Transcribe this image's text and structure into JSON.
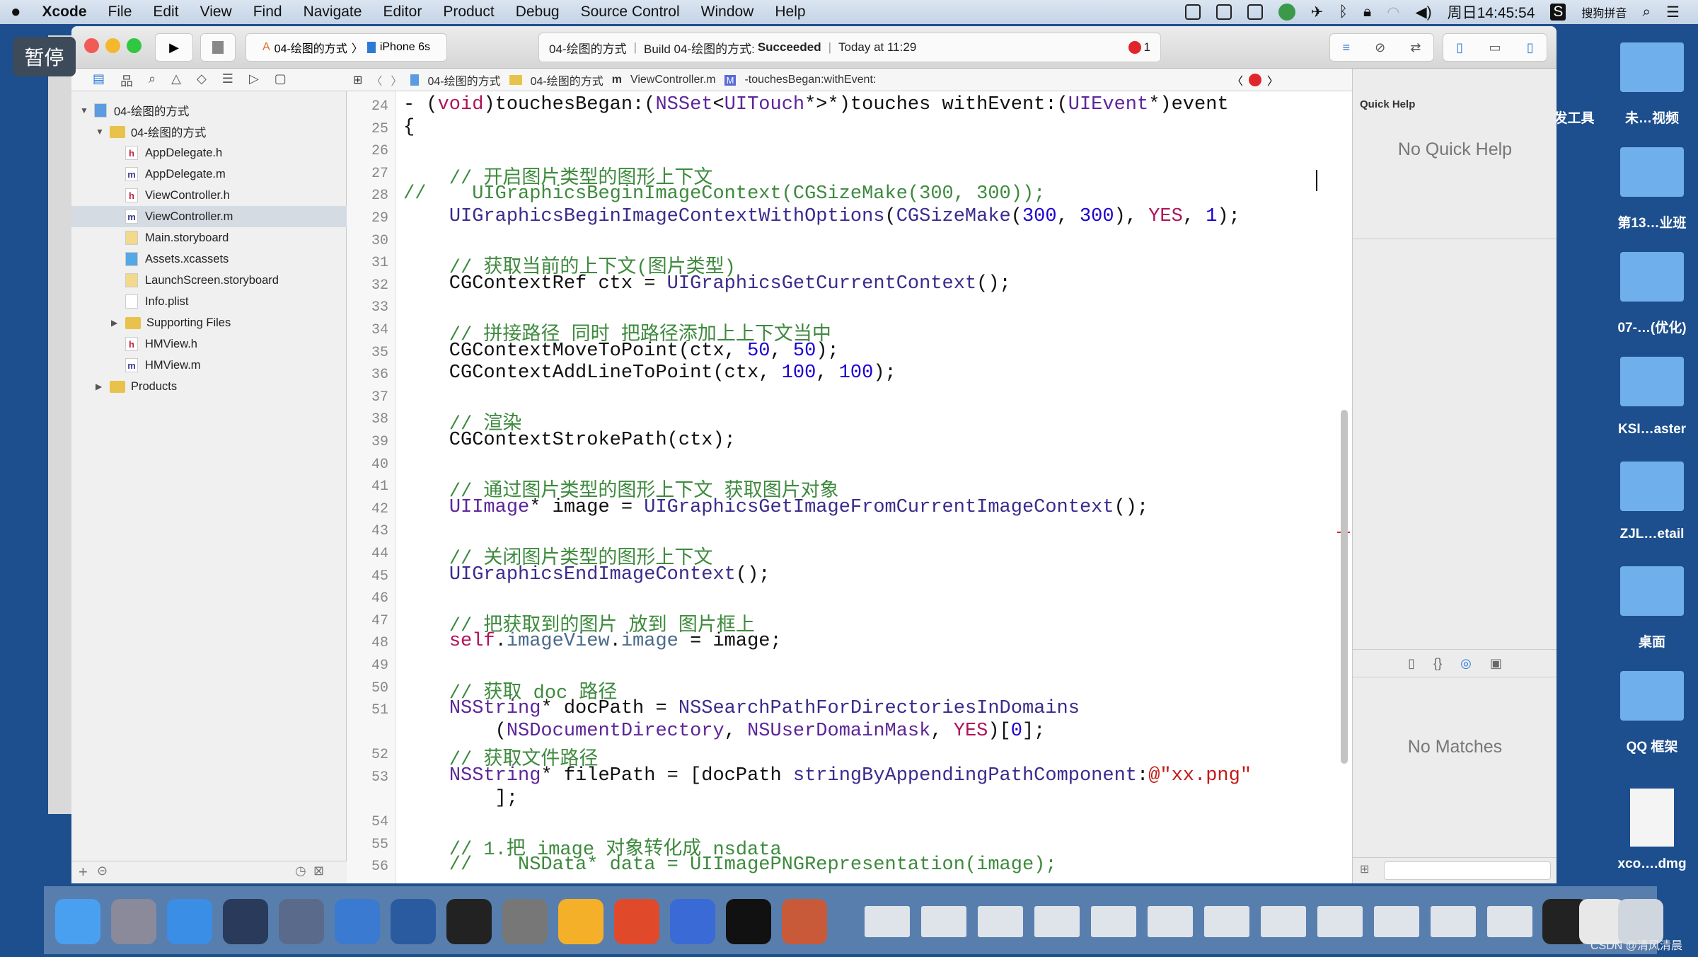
{
  "menubar": {
    "app": "Xcode",
    "items": [
      "File",
      "Edit",
      "View",
      "Find",
      "Navigate",
      "Editor",
      "Product",
      "Debug",
      "Source Control",
      "Window",
      "Help"
    ],
    "clock": "周日14:45:54",
    "ime": "搜狗拼音"
  },
  "overlay": {
    "pause": "暂停"
  },
  "toolbar": {
    "scheme": "04-绘图的方式",
    "device": "iPhone 6s",
    "activity_project": "04-绘图的方式",
    "activity_status_prefix": "Build 04-绘图的方式:",
    "activity_status": "Succeeded",
    "activity_time": "Today at 11:29",
    "issue_count": "1",
    "error_color": "#e0262a"
  },
  "pathbar": {
    "crumbs": [
      "04-绘图的方式",
      "04-绘图的方式",
      "ViewController.m",
      "-touchesBegan:withEvent:"
    ]
  },
  "navigator": {
    "items": [
      {
        "label": "04-绘图的方式",
        "type": "project",
        "depth": 0,
        "expanded": true
      },
      {
        "label": "04-绘图的方式",
        "type": "folder",
        "depth": 1,
        "expanded": true
      },
      {
        "label": "AppDelegate.h",
        "type": "h",
        "depth": 2
      },
      {
        "label": "AppDelegate.m",
        "type": "m",
        "depth": 2
      },
      {
        "label": "ViewController.h",
        "type": "h",
        "depth": 2
      },
      {
        "label": "ViewController.m",
        "type": "m",
        "depth": 2,
        "selected": true
      },
      {
        "label": "Main.storyboard",
        "type": "sb",
        "depth": 2
      },
      {
        "label": "Assets.xcassets",
        "type": "assets",
        "depth": 2
      },
      {
        "label": "LaunchScreen.storyboard",
        "type": "sb",
        "depth": 2
      },
      {
        "label": "Info.plist",
        "type": "plist",
        "depth": 2
      },
      {
        "label": "Supporting Files",
        "type": "folder",
        "depth": 2,
        "expanded": false
      },
      {
        "label": "HMView.h",
        "type": "h",
        "depth": 2
      },
      {
        "label": "HMView.m",
        "type": "m",
        "depth": 2
      },
      {
        "label": "Products",
        "type": "folder",
        "depth": 1,
        "expanded": false
      }
    ]
  },
  "editor": {
    "lines": [
      {
        "n": "24",
        "t": [
          [
            "- (",
            ""
          ],
          [
            "void",
            "kw"
          ],
          [
            ")touchesBegan:(",
            ""
          ],
          [
            "NSSet",
            "ty"
          ],
          [
            "<",
            ""
          ],
          [
            "UITouch",
            "ty"
          ],
          [
            "*>*)touches withEvent:(",
            ""
          ],
          [
            "UIEvent",
            "ty"
          ],
          [
            "*)event",
            ""
          ]
        ]
      },
      {
        "n": "25",
        "t": [
          [
            "{",
            ""
          ]
        ]
      },
      {
        "n": "26",
        "t": []
      },
      {
        "n": "27",
        "t": [
          [
            "    // 开启图片类型的图形上下文",
            "cm"
          ]
        ]
      },
      {
        "n": "28",
        "t": [
          [
            "//    UIGraphicsBeginImageContext(CGSizeMake(300, 300));",
            "cm"
          ]
        ]
      },
      {
        "n": "29",
        "t": [
          [
            "    ",
            ""
          ],
          [
            "UIGraphicsBeginImageContextWithOptions",
            "fn"
          ],
          [
            "(",
            ""
          ],
          [
            "CGSizeMake",
            "fn"
          ],
          [
            "(",
            ""
          ],
          [
            "300",
            "num"
          ],
          [
            ", ",
            ""
          ],
          [
            "300",
            "num"
          ],
          [
            "), ",
            ""
          ],
          [
            "YES",
            "kw"
          ],
          [
            ", ",
            ""
          ],
          [
            "1",
            "num"
          ],
          [
            ");",
            ""
          ]
        ]
      },
      {
        "n": "30",
        "t": []
      },
      {
        "n": "31",
        "t": [
          [
            "    // 获取当前的上下文(图片类型)",
            "cm"
          ]
        ]
      },
      {
        "n": "32",
        "t": [
          [
            "    CGContextRef ctx = ",
            ""
          ],
          [
            "UIGraphicsGetCurrentContext",
            "fn"
          ],
          [
            "();",
            ""
          ]
        ]
      },
      {
        "n": "33",
        "t": []
      },
      {
        "n": "34",
        "t": [
          [
            "    // 拼接路径 同时 把路径添加上上下文当中",
            "cm"
          ]
        ]
      },
      {
        "n": "35",
        "t": [
          [
            "    CGContextMoveToPoint(ctx, ",
            ""
          ],
          [
            "50",
            "num"
          ],
          [
            ", ",
            ""
          ],
          [
            "50",
            "num"
          ],
          [
            ");",
            ""
          ]
        ]
      },
      {
        "n": "36",
        "t": [
          [
            "    CGContextAddLineToPoint(ctx, ",
            ""
          ],
          [
            "100",
            "num"
          ],
          [
            ", ",
            ""
          ],
          [
            "100",
            "num"
          ],
          [
            ");",
            ""
          ]
        ]
      },
      {
        "n": "37",
        "t": []
      },
      {
        "n": "38",
        "t": [
          [
            "    // 渲染",
            "cm"
          ]
        ]
      },
      {
        "n": "39",
        "t": [
          [
            "    CGContextStrokePath(ctx);",
            ""
          ]
        ]
      },
      {
        "n": "40",
        "t": []
      },
      {
        "n": "41",
        "t": [
          [
            "    // 通过图片类型的图形上下文 获取图片对象",
            "cm"
          ]
        ]
      },
      {
        "n": "42",
        "t": [
          [
            "    ",
            ""
          ],
          [
            "UIImage",
            "ty"
          ],
          [
            "* image = ",
            ""
          ],
          [
            "UIGraphicsGetImageFromCurrentImageContext",
            "fn"
          ],
          [
            "();",
            ""
          ]
        ]
      },
      {
        "n": "43",
        "t": []
      },
      {
        "n": "44",
        "t": [
          [
            "    // 关闭图片类型的图形上下文",
            "cm"
          ]
        ]
      },
      {
        "n": "45",
        "t": [
          [
            "    ",
            ""
          ],
          [
            "UIGraphicsEndImageContext",
            "fn"
          ],
          [
            "();",
            ""
          ]
        ]
      },
      {
        "n": "46",
        "t": []
      },
      {
        "n": "47",
        "t": [
          [
            "    // 把获取到的图片 放到 图片框上",
            "cm"
          ]
        ]
      },
      {
        "n": "48",
        "t": [
          [
            "    ",
            ""
          ],
          [
            "self",
            "kw"
          ],
          [
            ".",
            ""
          ],
          [
            "imageView",
            "pr"
          ],
          [
            ".",
            ""
          ],
          [
            "image",
            "pr"
          ],
          [
            " = image;",
            ""
          ]
        ]
      },
      {
        "n": "49",
        "t": []
      },
      {
        "n": "50",
        "t": [
          [
            "    // 获取 doc 路径",
            "cm"
          ]
        ]
      },
      {
        "n": "51",
        "t": [
          [
            "    ",
            ""
          ],
          [
            "NSString",
            "ty"
          ],
          [
            "* docPath = ",
            ""
          ],
          [
            "NSSearchPathForDirectoriesInDomains",
            "fn"
          ]
        ]
      },
      {
        "n": "",
        "t": [
          [
            "        (",
            ""
          ],
          [
            "NSDocumentDirectory",
            "ty"
          ],
          [
            ", ",
            ""
          ],
          [
            "NSUserDomainMask",
            "ty"
          ],
          [
            ", ",
            ""
          ],
          [
            "YES",
            "kw"
          ],
          [
            ")[",
            ""
          ],
          [
            "0",
            "num"
          ],
          [
            "];",
            ""
          ]
        ]
      },
      {
        "n": "52",
        "t": [
          [
            "    // 获取文件路径",
            "cm"
          ]
        ]
      },
      {
        "n": "53",
        "t": [
          [
            "    ",
            ""
          ],
          [
            "NSString",
            "ty"
          ],
          [
            "* filePath = [docPath ",
            ""
          ],
          [
            "stringByAppendingPathComponent",
            "fn"
          ],
          [
            ":",
            ""
          ],
          [
            "@\"xx.png\"",
            "str"
          ]
        ]
      },
      {
        "n": "",
        "t": [
          [
            "        ];",
            ""
          ]
        ]
      },
      {
        "n": "54",
        "t": []
      },
      {
        "n": "55",
        "t": [
          [
            "    // 1.把 image 对象转化成 nsdata",
            "cm"
          ]
        ]
      },
      {
        "n": "56",
        "t": [
          [
            "    //    NSData* data = UIImagePNGRepresentation(image);",
            "cm"
          ]
        ]
      }
    ]
  },
  "inspector": {
    "title": "Quick Help",
    "empty": "No Quick Help",
    "library_empty": "No Matches"
  },
  "desktop": {
    "items": [
      "发工具",
      "未…视频",
      "第13…业班",
      "07-…(优化)",
      "KSI…aster",
      "ZJL…etail",
      "桌面",
      "QQ 框架",
      "xco….dmg"
    ]
  },
  "watermark": "CSDN @清风清晨"
}
